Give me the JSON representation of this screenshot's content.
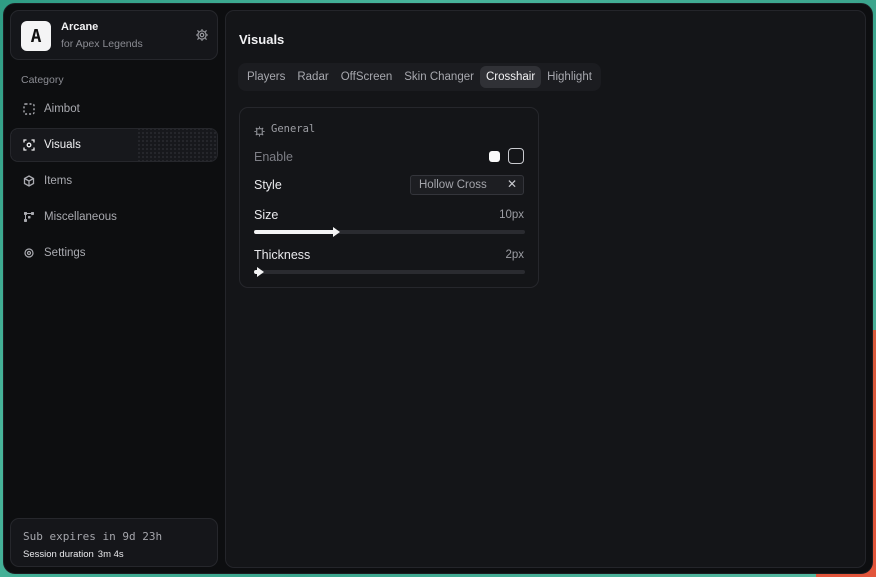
{
  "brand": {
    "name": "Arcane",
    "subtitle": "for Apex Legends",
    "logo_letter": "A"
  },
  "sidebar": {
    "category_label": "Category",
    "items": [
      {
        "label": "Aimbot",
        "icon": "dashed-square-icon",
        "active": false
      },
      {
        "label": "Visuals",
        "icon": "scan-eye-icon",
        "active": true
      },
      {
        "label": "Items",
        "icon": "cube-icon",
        "active": false
      },
      {
        "label": "Miscellaneous",
        "icon": "nodes-icon",
        "active": false
      },
      {
        "label": "Settings",
        "icon": "gear-icon",
        "active": false
      }
    ]
  },
  "subscription": {
    "expires_text": "Sub expires in 9d 23h",
    "session_label": "Session duration",
    "session_value": "3m 4s"
  },
  "main": {
    "title": "Visuals",
    "tabs": [
      {
        "label": "Players",
        "active": false
      },
      {
        "label": "Radar",
        "active": false
      },
      {
        "label": "OffScreen",
        "active": false
      },
      {
        "label": "Skin Changer",
        "active": false
      },
      {
        "label": "Crosshair",
        "active": true
      },
      {
        "label": "Highlight",
        "active": false
      }
    ],
    "card": {
      "title": "General",
      "enable": {
        "label": "Enable",
        "color": "#fafafa",
        "checked": false
      },
      "style": {
        "label": "Style",
        "value": "Hollow Cross",
        "clear_glyph": "✕"
      },
      "size": {
        "label": "Size",
        "value_text": "10px",
        "value": 10,
        "max": 33
      },
      "thickness": {
        "label": "Thickness",
        "value_text": "2px",
        "value": 2,
        "max": 100
      }
    }
  }
}
